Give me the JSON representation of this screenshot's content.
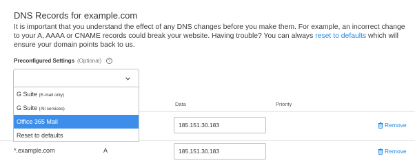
{
  "header": {
    "title": "DNS Records for example.com"
  },
  "description": {
    "text_before_link": "It is important that you understand the effect of any DNS changes before you make them. For example, an incorrect change to your A, AAAA or CNAME records could break your website.  Having trouble? You can always ",
    "link_text": "reset to defaults",
    "text_after_link": " which will ensure your domain points back to us."
  },
  "preconfigured": {
    "label": "Preconfigured Settings",
    "optional": "(Optional)",
    "help_glyph": "?",
    "selected_value": "",
    "chevron_icon": "chevron-down-icon",
    "options": [
      {
        "main": "G Suite",
        "small": "(E-mail only)"
      },
      {
        "main": "G Suite",
        "small": "(All services)"
      },
      {
        "main": "Office 365 Mail",
        "small": ""
      },
      {
        "main": "Reset to defaults",
        "small": ""
      }
    ],
    "highlighted_index": 2
  },
  "table": {
    "columns": {
      "data": "Data",
      "priority": "Priority"
    },
    "rows": [
      {
        "host": "",
        "type": "",
        "data": "185.151.30.183",
        "remove_label": "Remove"
      },
      {
        "host": "*.example.com",
        "type": "A",
        "data": "185.151.30.183",
        "remove_label": "Remove"
      }
    ]
  },
  "colors": {
    "link": "#1e88e5",
    "highlight": "#3d8eea"
  }
}
